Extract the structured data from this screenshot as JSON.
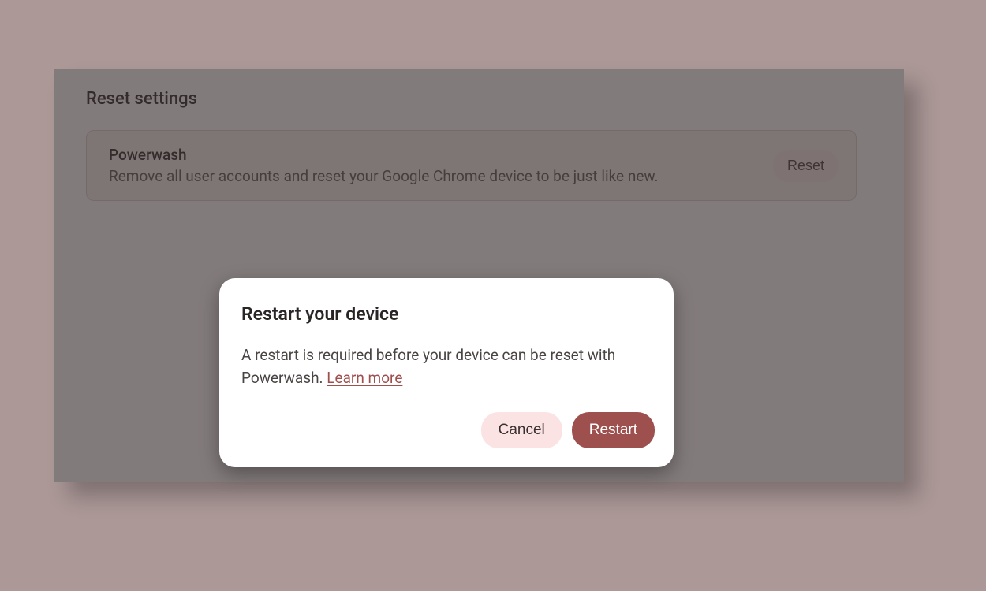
{
  "section": {
    "title": "Reset settings"
  },
  "powerwash": {
    "label": "Powerwash",
    "description": "Remove all user accounts and reset your Google Chrome device to be just like new.",
    "action_label": "Reset"
  },
  "dialog": {
    "title": "Restart your device",
    "body_text": "A restart is required before your device can be reset with Powerwash. ",
    "learn_more_label": "Learn more",
    "cancel_label": "Cancel",
    "confirm_label": "Restart"
  },
  "colors": {
    "accent": "#9e504e",
    "accent_light": "#fbe3e3",
    "page_bg": "#ab9897",
    "panel_bg": "#f8f3f3"
  }
}
